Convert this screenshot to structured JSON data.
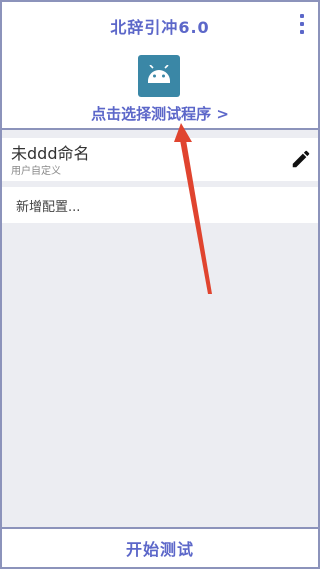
{
  "header": {
    "title": "北辞引冲6.0",
    "pick_app_label": "点击选择测试程序 >"
  },
  "config": {
    "name": "未ddd命名",
    "subtitle": "用户自定义"
  },
  "add_config_label": "新增配置...",
  "bottom_button_label": "开始测试",
  "colors": {
    "accent": "#5c67c9",
    "border": "#8c93bb",
    "app_icon_bg": "#3a87a6",
    "list_bg": "#ecedf2",
    "arrow": "#e0442f"
  },
  "icons": {
    "menu": "more-vertical-icon",
    "app": "android-icon",
    "edit": "pencil-icon"
  }
}
